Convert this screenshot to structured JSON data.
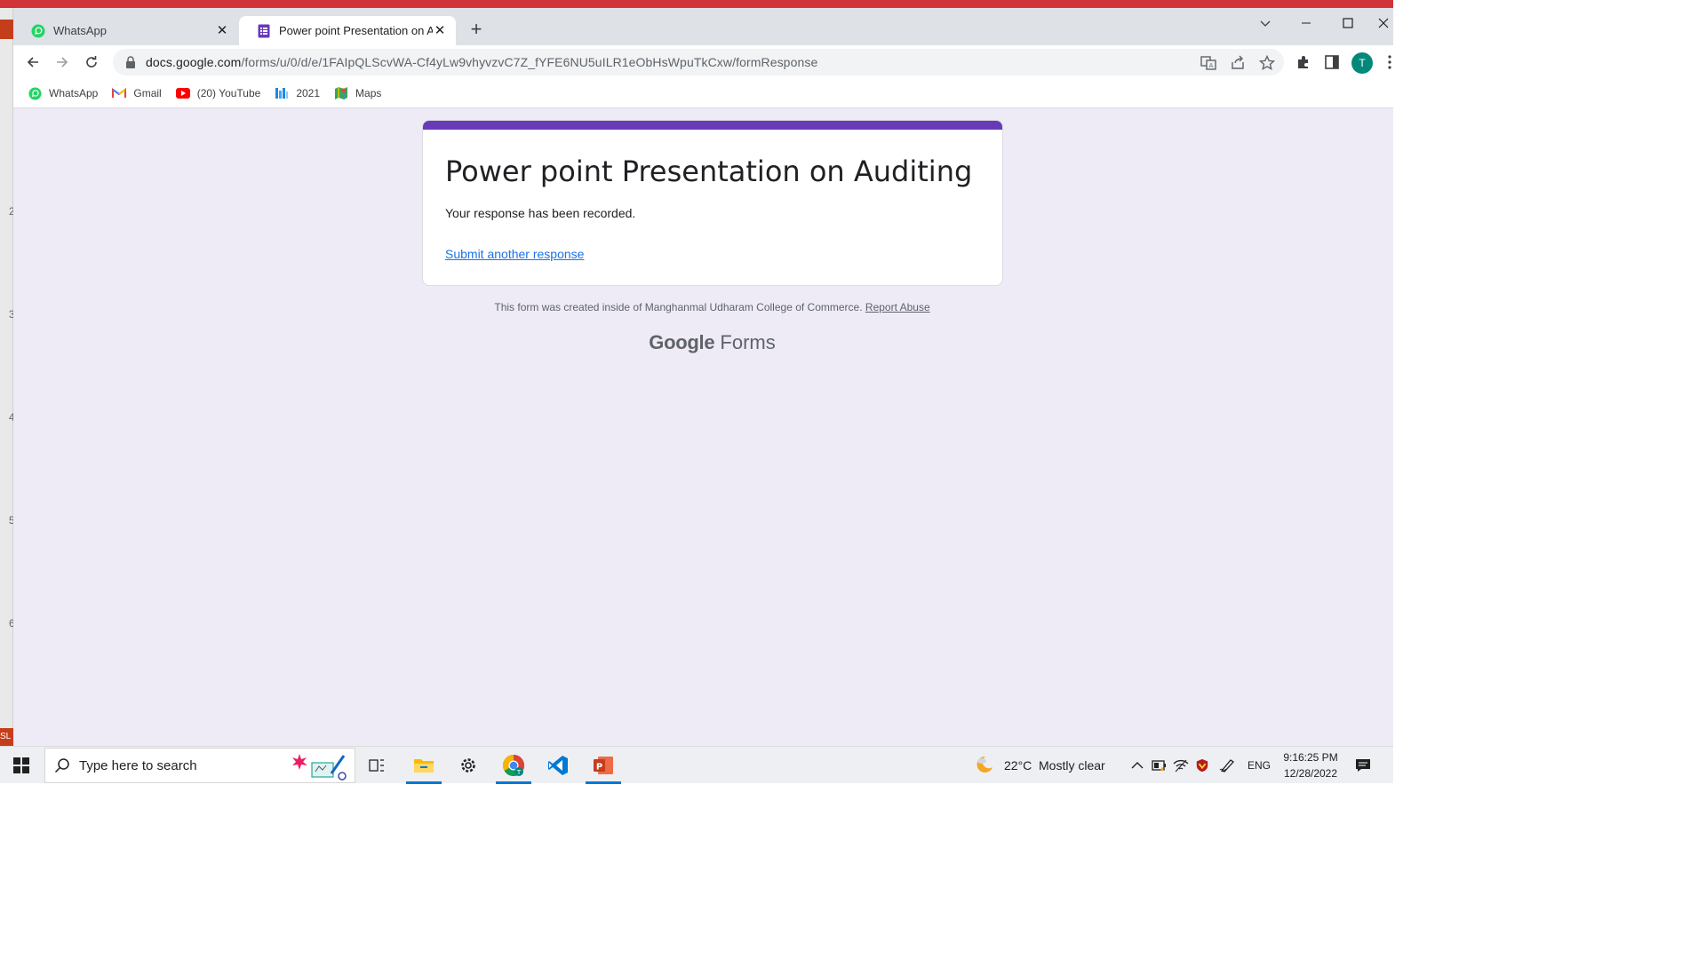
{
  "colors": {
    "form_accent": "#673ab7",
    "page_background": "#eeebf7",
    "link": "#1a73e8",
    "ppt_red": "#d13438",
    "avatar": "#00897b"
  },
  "background_app": {
    "ruler_numbers": [
      "2",
      "3",
      "4",
      "5",
      "6"
    ],
    "slide_badge": "SL"
  },
  "browser": {
    "tabs": [
      {
        "title": "WhatsApp",
        "icon": "whatsapp-icon",
        "active": false
      },
      {
        "title": "Power point Presentation on Auditing",
        "icon": "google-forms-icon",
        "active": true
      }
    ],
    "address": {
      "host": "docs.google.com",
      "path": "/forms/u/0/d/e/1FAIpQLScvWA-Cf4yLw9vhyvzvC7Z_fYFE6NU5uILR1eObHsWpuTkCxw/formResponse"
    },
    "profile_initial": "T",
    "bookmarks": [
      {
        "label": "WhatsApp",
        "icon": "whatsapp-icon"
      },
      {
        "label": "Gmail",
        "icon": "gmail-icon"
      },
      {
        "label": "(20) YouTube",
        "icon": "youtube-icon"
      },
      {
        "label": "2021",
        "icon": "site-icon"
      },
      {
        "label": "Maps",
        "icon": "maps-icon"
      }
    ]
  },
  "form": {
    "title": "Power point Presentation on Auditing",
    "confirmation": "Your response has been recorded.",
    "submit_another": "Submit another response",
    "footer_text": "This form was created inside of Manghanmal Udharam College of Commerce.",
    "report_abuse": "Report Abuse",
    "logo_google": "Google",
    "logo_forms": "Forms"
  },
  "taskbar": {
    "search_placeholder": "Type here to search",
    "weather_temp": "22°C",
    "weather_desc": "Mostly clear",
    "language": "ENG",
    "time": "9:16:25 PM",
    "date": "12/28/2022"
  }
}
